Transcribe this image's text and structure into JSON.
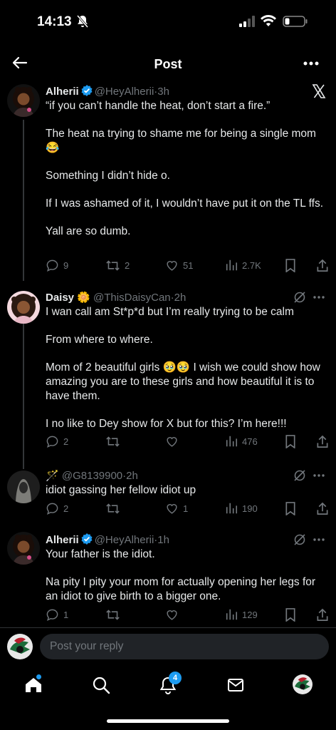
{
  "status_bar": {
    "time": "14:13"
  },
  "header": {
    "title": "Post"
  },
  "posts": [
    {
      "name": "Alherii",
      "handle": "@HeyAlherii",
      "ago": "3h",
      "paragraphs": [
        "“if you can’t handle the heat, don’t start a fire.”",
        "The heat na trying to shame me for being a single mom 😂",
        "Something I didn’t hide o.",
        "If I was ashamed of it, I wouldn’t have put it on the TL ffs.",
        "Yall are so dumb."
      ],
      "replies": "9",
      "reposts": "2",
      "likes": "51",
      "views": "2.7K"
    },
    {
      "name": "Daisy 🌼",
      "handle": "@ThisDaisyCan",
      "ago": "2h",
      "paragraphs": [
        "I wan call am St*p*d but I’m really trying to be calm",
        "From where to where.",
        "Mom of 2 beautiful girls 🥹🥹 I wish we could show how amazing you are to these girls and how beautiful it is to have them.",
        "I no like to Dey show for X but for this? I’m here!!!"
      ],
      "replies": "2",
      "reposts": "",
      "likes": "",
      "views": "476"
    },
    {
      "name": "🪄",
      "handle": "@G8139900",
      "ago": "2h",
      "paragraphs": [
        "idiot gassing her fellow idiot up"
      ],
      "replies": "2",
      "reposts": "",
      "likes": "1",
      "views": "190"
    },
    {
      "name": "Alherii",
      "handle": "@HeyAlherii",
      "ago": "1h",
      "paragraphs": [
        "Your father is the idiot.",
        "Na pity I pity your mom for actually opening her legs for an idiot to give birth to a bigger one."
      ],
      "replies": "1",
      "reposts": "",
      "likes": "",
      "views": "129"
    }
  ],
  "reply_bar": {
    "placeholder": "Post your reply"
  },
  "tab_bar": {
    "notification_count": "4"
  },
  "colors": {
    "accent": "#1d9bf0",
    "muted": "#71767b",
    "background": "#000000",
    "text": "#e7e9ea"
  },
  "icons": [
    "back-arrow-icon",
    "more-icon",
    "x-logo-icon",
    "verified-icon",
    "grok-icon",
    "reply-icon",
    "repost-icon",
    "like-icon",
    "views-icon",
    "bookmark-icon",
    "share-icon",
    "home-icon",
    "search-icon",
    "bell-icon",
    "mail-icon"
  ]
}
